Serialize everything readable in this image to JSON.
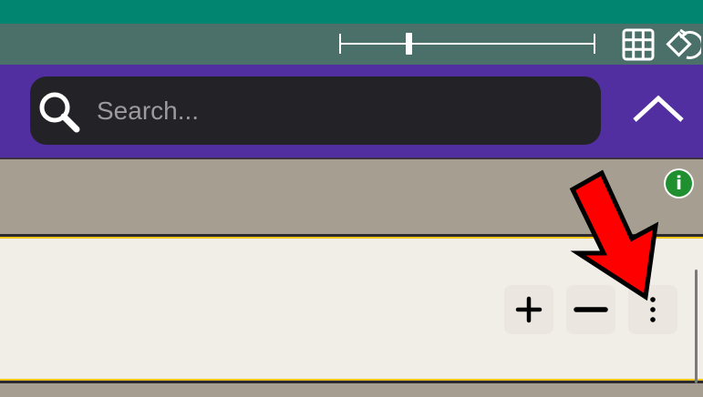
{
  "toolbar": {
    "slider_value_fraction": 0.27,
    "grid_icon": "grid-icon",
    "rotate_icon": "rotate-icon"
  },
  "search": {
    "placeholder": "Search...",
    "value": ""
  },
  "info": {
    "glyph": "i"
  },
  "row_controls": {
    "plus_glyph": "+",
    "minus_glyph": "−",
    "more_glyph": "⋮"
  },
  "colors": {
    "top_bar": "#018571",
    "toolbar": "#4a7069",
    "search_bar": "#522fa0",
    "search_box": "#232226",
    "info_badge": "#1f8f2f",
    "panel_background": "#f1ede7",
    "panel_accent": "#f2c518",
    "annotation_arrow": "#ff0000"
  }
}
